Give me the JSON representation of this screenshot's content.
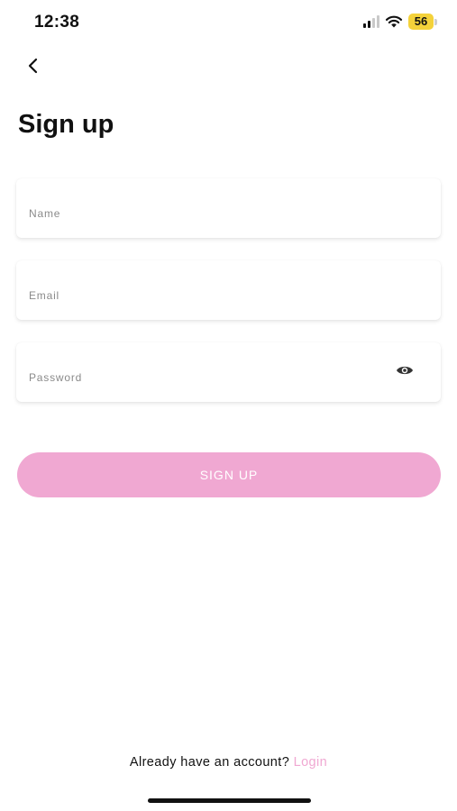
{
  "status_bar": {
    "time": "12:38",
    "battery": "56",
    "battery_color": "#f4d23a"
  },
  "header": {
    "back_icon": "chevron-left-icon",
    "title": "Sign up"
  },
  "form": {
    "name_placeholder": "Name",
    "name_value": "",
    "email_placeholder": "Email",
    "email_value": "",
    "password_placeholder": "Password",
    "password_value": "",
    "password_toggle_icon": "eye-icon",
    "submit_label": "SIGN UP",
    "accent_color": "#f0a8d2"
  },
  "footer": {
    "prompt": "Already have an account?",
    "link_label": "Login"
  }
}
